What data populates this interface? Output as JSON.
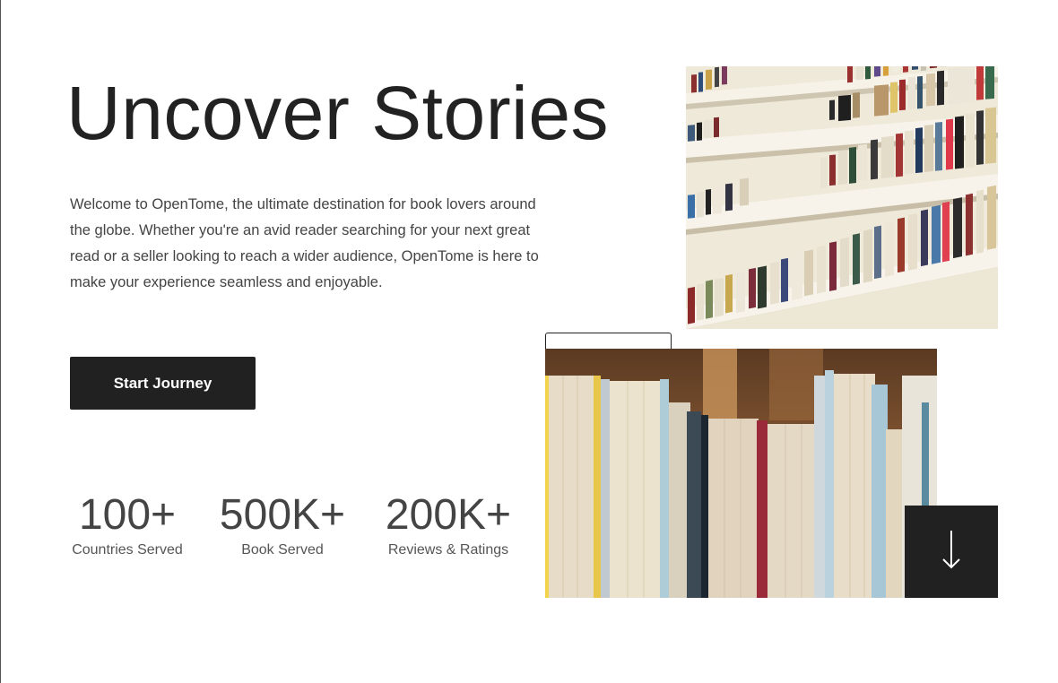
{
  "hero": {
    "title": "Uncover Stories",
    "description": "Welcome to OpenTome, the ultimate destination for book lovers around the globe. Whether you're an avid reader searching for your next great read or a seller looking to reach a wider audience, OpenTome is here to make your experience seamless and enjoyable.",
    "cta_label": "Start Journey"
  },
  "stats": [
    {
      "value": "100+",
      "label": "Countries Served"
    },
    {
      "value": "500K+",
      "label": "Book Served"
    },
    {
      "value": "200K+",
      "label": "Reviews & Ratings"
    }
  ],
  "images": {
    "shelves": "bookshelf-photo",
    "spines": "book-spines-photo"
  },
  "icons": {
    "scroll": "arrow-down-icon"
  },
  "colors": {
    "primary_dark": "#212121",
    "text": "#222222",
    "muted": "#444444"
  }
}
